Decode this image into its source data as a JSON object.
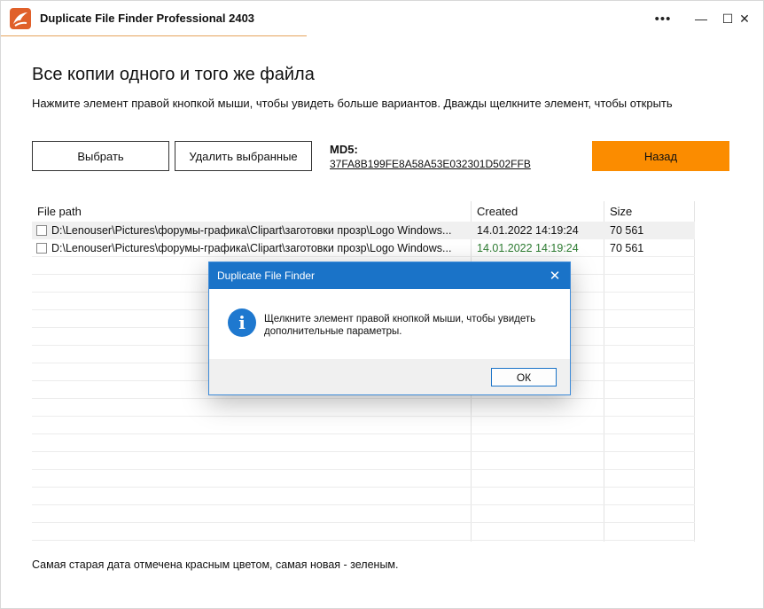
{
  "window": {
    "title": "Duplicate File Finder Professional 2403",
    "dots": "•••",
    "minimize": "—",
    "maximize": "☐",
    "close": "✕"
  },
  "page": {
    "heading": "Все копии одного и того же файла",
    "subheading": "Нажмите элемент правой кнопкой мыши, чтобы увидеть больше вариантов. Дважды щелкните элемент, чтобы открыть"
  },
  "toolbar": {
    "select_label": "Выбрать",
    "delete_label": "Удалить выбранные",
    "back_label": "Назад",
    "md5_label": "MD5:",
    "md5_value": "37FA8B199FE8A58A53E032301D502FFB"
  },
  "table": {
    "columns": [
      "File path",
      "Created",
      "Size"
    ],
    "rows": [
      {
        "path": "D:\\Lenouser\\Pictures\\форумы-графика\\Clipart\\заготовки прозр\\Logo Windows...",
        "created": "14.01.2022 14:19:24",
        "size": "70 561",
        "checked": false,
        "created_color": "#111111"
      },
      {
        "path": "D:\\Lenouser\\Pictures\\форумы-графика\\Clipart\\заготовки прозр\\Logo Windows...",
        "created": "14.01.2022 14:19:24",
        "size": "70 561",
        "checked": false,
        "created_color": "#2e7d32"
      }
    ]
  },
  "footer": {
    "note": "Самая старая дата отмечена красным цветом, самая новая - зеленым."
  },
  "dialog": {
    "title": "Duplicate File Finder",
    "close": "✕",
    "icon": "info-icon",
    "icon_glyph": "i",
    "message": "Щелкните элемент правой кнопкой мыши, чтобы увидеть дополнительные параметры.",
    "ok_label": "ОК"
  },
  "colors": {
    "accent_orange": "#fb8c00",
    "dialog_blue": "#1a73c8",
    "newest_green": "#2e7d32"
  }
}
